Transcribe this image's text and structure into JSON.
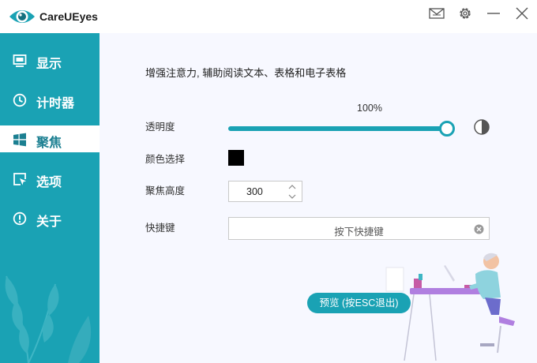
{
  "app": {
    "title": "CareUEyes"
  },
  "window_controls": [
    {
      "name": "mail-icon"
    },
    {
      "name": "gear-icon"
    },
    {
      "name": "minimize-icon"
    },
    {
      "name": "close-icon"
    }
  ],
  "sidebar": {
    "items": [
      {
        "label": "显示",
        "icon": "monitor-icon",
        "active": false
      },
      {
        "label": "计时器",
        "icon": "clock-icon",
        "active": false
      },
      {
        "label": "聚焦",
        "icon": "windows-icon",
        "active": true
      },
      {
        "label": "选项",
        "icon": "cursor-box-icon",
        "active": false
      },
      {
        "label": "关于",
        "icon": "info-icon",
        "active": false
      }
    ]
  },
  "focus": {
    "description": "增强注意力, 辅助阅读文本、表格和电子表格",
    "transparency": {
      "label": "透明度",
      "value_text": "100%",
      "value": 100
    },
    "color": {
      "label": "颜色选择",
      "value": "#000000"
    },
    "height": {
      "label": "聚焦高度",
      "value": "300"
    },
    "hotkey": {
      "label": "快捷键",
      "placeholder": "按下快捷键"
    },
    "preview_button": "预览 (按ESC退出)"
  },
  "colors": {
    "accent": "#1aa2b4",
    "sidebar_bg": "#1aa2b4",
    "content_bg": "#f7f8ff"
  }
}
